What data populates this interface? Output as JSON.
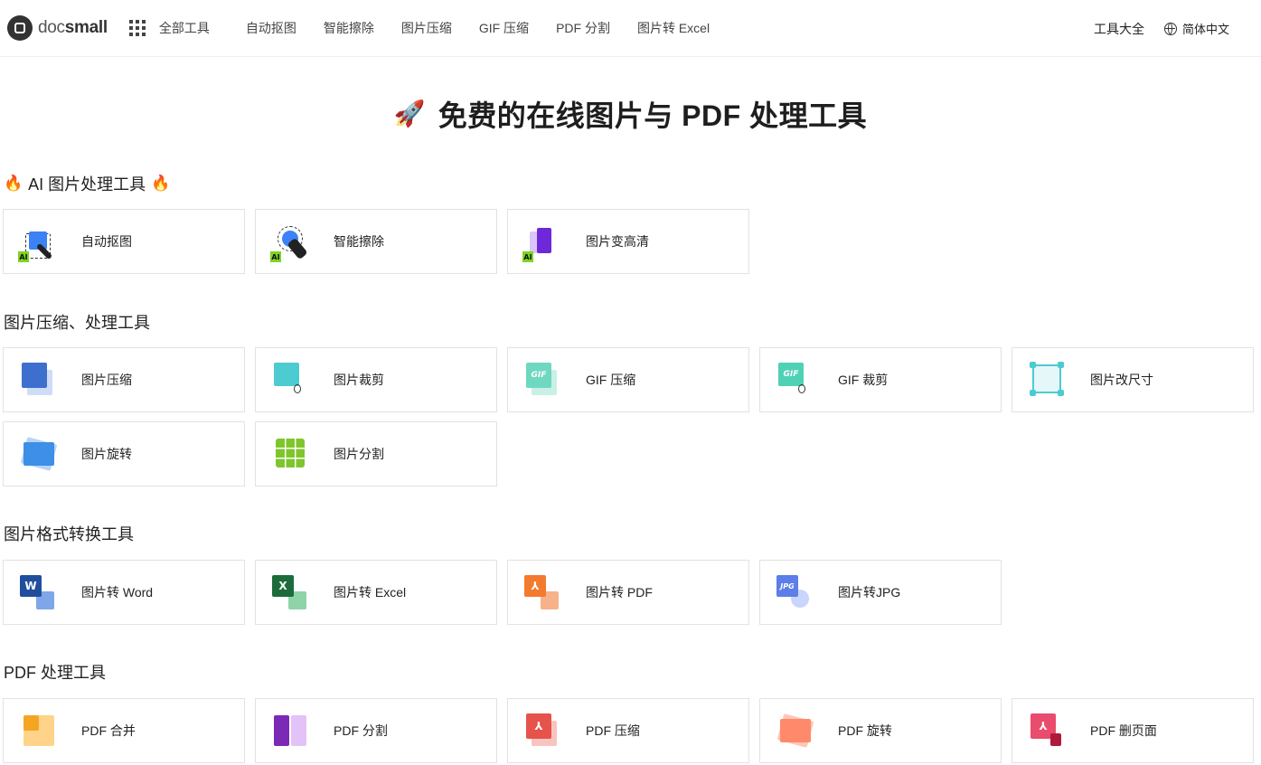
{
  "header": {
    "logo_prefix": "doc",
    "logo_suffix": "small",
    "nav": [
      "全部工具",
      "自动抠图",
      "智能擦除",
      "图片压缩",
      "GIF 压缩",
      "PDF 分割",
      "图片转 Excel"
    ],
    "tools_all": "工具大全",
    "language": "简体中文"
  },
  "hero": {
    "title": "免费的在线图片与 PDF 处理工具",
    "emoji": "🚀"
  },
  "sections": {
    "ai": {
      "title": "AI 图片处理工具",
      "flame": "🔥",
      "items": [
        "自动抠图",
        "智能擦除",
        "图片变高清"
      ]
    },
    "image": {
      "title": "图片压缩、处理工具",
      "items": [
        "图片压缩",
        "图片裁剪",
        "GIF 压缩",
        "GIF 裁剪",
        "图片改尺寸",
        "图片旋转",
        "图片分割"
      ]
    },
    "convert": {
      "title": "图片格式转换工具",
      "items": [
        "图片转 Word",
        "图片转 Excel",
        "图片转 PDF",
        "图片转JPG"
      ]
    },
    "pdf": {
      "title": "PDF 处理工具",
      "items": [
        "PDF 合并",
        "PDF 分割",
        "PDF 压缩",
        "PDF 旋转",
        "PDF 删页面"
      ]
    }
  },
  "icon_glyphs": {
    "ai": "AI",
    "gif": "GIF",
    "word": "W",
    "excel": "X",
    "jpg": "JPG"
  },
  "colors": {
    "ai_blue": "#3b82f6",
    "ai_purple": "#6d28d9",
    "ai_green": "#7ed321",
    "compress_blue": "#3d6fcf",
    "teal": "#4ccbd0",
    "gif_green": "#4fd1b5",
    "word": "#1f4f9c",
    "excel": "#1d6b3a",
    "pdf_orange": "#f37b2d",
    "jpg": "#5b7ee8",
    "pdf_merge": "#f5a524",
    "pdf_split": "#7b2ab8",
    "pdf_red": "#e5534b",
    "pdf_rotate": "#ff8a6b",
    "pdf_delete": "#e94c6c"
  }
}
